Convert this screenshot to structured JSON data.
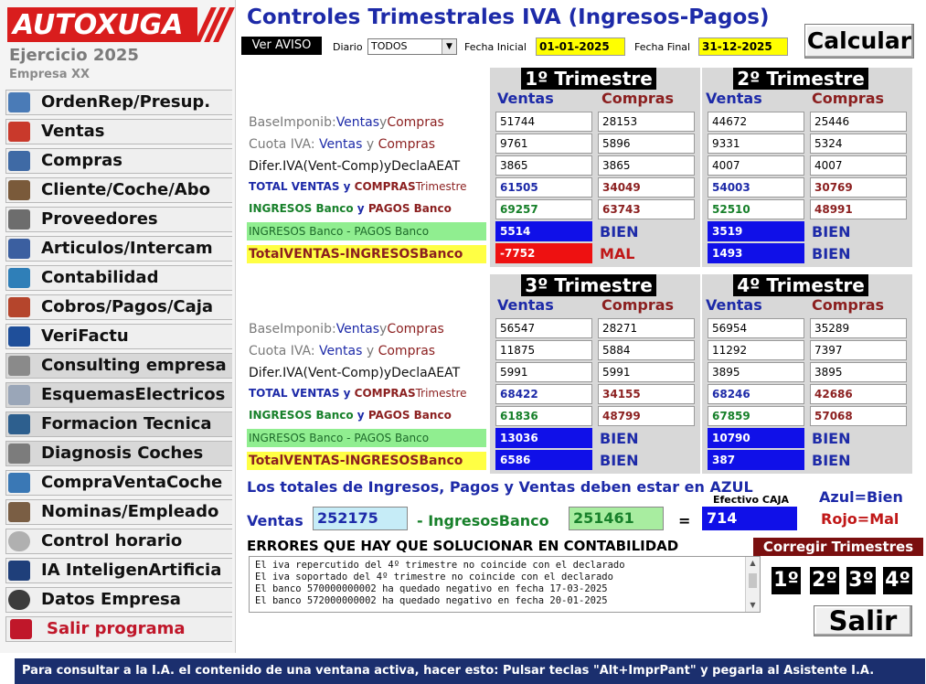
{
  "colors": {
    "brand_red": "#d91d1d",
    "title_blue": "#1d2aa8",
    "ok_blue": "#1010e8",
    "bad_red": "#ee1111",
    "status_bar": "#1b2f6e"
  },
  "sidebar": {
    "logo": "AUTOXUGA",
    "ejercicio": "Ejercicio 2025",
    "empresa": "Empresa XX",
    "items": [
      {
        "label": "OrdenRep/Presup.",
        "icon": "repair-order-icon"
      },
      {
        "label": "Ventas",
        "icon": "sales-chart-icon"
      },
      {
        "label": "Compras",
        "icon": "purchases-icon"
      },
      {
        "label": "Cliente/Coche/Abo",
        "icon": "customers-icon"
      },
      {
        "label": "Proveedores",
        "icon": "suppliers-icon"
      },
      {
        "label": "Articulos/Intercam",
        "icon": "articles-icon"
      },
      {
        "label": "Contabilidad",
        "icon": "accounting-icon"
      },
      {
        "label": "Cobros/Pagos/Caja",
        "icon": "payments-icon"
      },
      {
        "label": "VeriFactu",
        "icon": "verifactu-icon"
      },
      {
        "label": "Consulting empresa",
        "icon": "consulting-icon"
      },
      {
        "label": "EsquemasElectricos",
        "icon": "wiring-diagram-icon"
      },
      {
        "label": "Formacion Tecnica",
        "icon": "training-icon"
      },
      {
        "label": "Diagnosis Coches",
        "icon": "car-diagnosis-icon"
      },
      {
        "label": "CompraVentaCoche",
        "icon": "car-trade-icon"
      },
      {
        "label": "Nominas/Empleado",
        "icon": "payroll-icon"
      },
      {
        "label": "Control horario",
        "icon": "clock-icon"
      },
      {
        "label": "IA InteligenArtificia",
        "icon": "ai-icon"
      },
      {
        "label": "Datos Empresa",
        "icon": "gear-icon"
      },
      {
        "label": "Salir programa",
        "icon": "exit-icon"
      }
    ]
  },
  "main": {
    "title": "Controles Trimestrales IVA (Ingresos-Pagos)",
    "ver_aviso": "Ver AVISO",
    "diario_label": "Diario",
    "diario_value": "TODOS",
    "fecha_inicial_label": "Fecha Inicial",
    "fecha_inicial": "01-01-2025",
    "fecha_final_label": "Fecha Final",
    "fecha_final": "31-12-2025",
    "calcular": "Calcular",
    "row_labels": {
      "base_a": "BaseImponib:",
      "base_b": "Ventas",
      "base_c": "y",
      "base_d": "Compras",
      "cuota_a": "Cuota IVA:",
      "cuota_b": "Ventas",
      "cuota_c": "y",
      "cuota_d": "Compras",
      "difer": "Difer.IVA(Vent-Comp)yDeclaAEAT",
      "total_a": "TOTAL VENTAS",
      "total_b": "y",
      "total_c": "COMPRAS",
      "total_d": "Trimestre",
      "ingresos_a": "INGRESOS Banco",
      "ingresos_b": "y",
      "ingresos_c": "PAGOS Banco",
      "banco": "INGRESOS Banco - PAGOS Banco",
      "totalventas": "TotalVENTAS-INGRESOSBanco"
    },
    "col_ventas": "Ventas",
    "col_compras": "Compras",
    "quarters": [
      {
        "title": "1º Trimestre",
        "base": [
          "51744",
          "28153"
        ],
        "cuota": [
          "9761",
          "5896"
        ],
        "difer": [
          "3865",
          "3865"
        ],
        "total": [
          "61505",
          "34049"
        ],
        "ingpag": [
          "69257",
          "63743"
        ],
        "banco": "5514",
        "banco_status": "BIEN",
        "totvi": "-7752",
        "totvi_status": "MAL"
      },
      {
        "title": "2º Trimestre",
        "base": [
          "44672",
          "25446"
        ],
        "cuota": [
          "9331",
          "5324"
        ],
        "difer": [
          "4007",
          "4007"
        ],
        "total": [
          "54003",
          "30769"
        ],
        "ingpag": [
          "52510",
          "48991"
        ],
        "banco": "3519",
        "banco_status": "BIEN",
        "totvi": "1493",
        "totvi_status": "BIEN"
      },
      {
        "title": "3º Trimestre",
        "base": [
          "56547",
          "28271"
        ],
        "cuota": [
          "11875",
          "5884"
        ],
        "difer": [
          "5991",
          "5991"
        ],
        "total": [
          "68422",
          "34155"
        ],
        "ingpag": [
          "61836",
          "48799"
        ],
        "banco": "13036",
        "banco_status": "BIEN",
        "totvi": "6586",
        "totvi_status": "BIEN"
      },
      {
        "title": "4º Trimestre",
        "base": [
          "56954",
          "35289"
        ],
        "cuota": [
          "11292",
          "7397"
        ],
        "difer": [
          "3895",
          "3895"
        ],
        "total": [
          "68246",
          "42686"
        ],
        "ingpag": [
          "67859",
          "57068"
        ],
        "banco": "10790",
        "banco_status": "BIEN",
        "totvi": "387",
        "totvi_status": "BIEN"
      }
    ],
    "totals": {
      "info": "Los totales de Ingresos, Pagos y Ventas deben estar en AZUL",
      "ventas_label": "Ventas",
      "ventas": "252175",
      "minus_ingresos_label": "- IngresosBanco",
      "ingresos": "251461",
      "equals": "=",
      "efectivo_label": "Efectivo CAJA",
      "efectivo": "714",
      "legend_blue": "Azul=Bien",
      "legend_red": "Rojo=Mal"
    },
    "errors": {
      "title": "ERRORES QUE HAY QUE SOLUCIONAR EN CONTABILIDAD",
      "lines": [
        "El iva repercutido del 4º trimestre no coincide con el declarado",
        "El iva soportado del 4º trimestre no coincide con el declarado",
        "El banco 570000000002 ha quedado negativo en fecha 17-03-2025",
        "El banco 572000000002 ha quedado negativo en fecha 20-01-2025"
      ]
    },
    "corregir": {
      "title": "Corregir Trimestres",
      "buttons": [
        "1º",
        "2º",
        "3º",
        "4º"
      ]
    },
    "salir": "Salir"
  },
  "status_bar": "Para consultar a la I.A. el contenido de una ventana activa, hacer esto: Pulsar teclas \"Alt+ImprPant\" y pegarla al Asistente I.A."
}
